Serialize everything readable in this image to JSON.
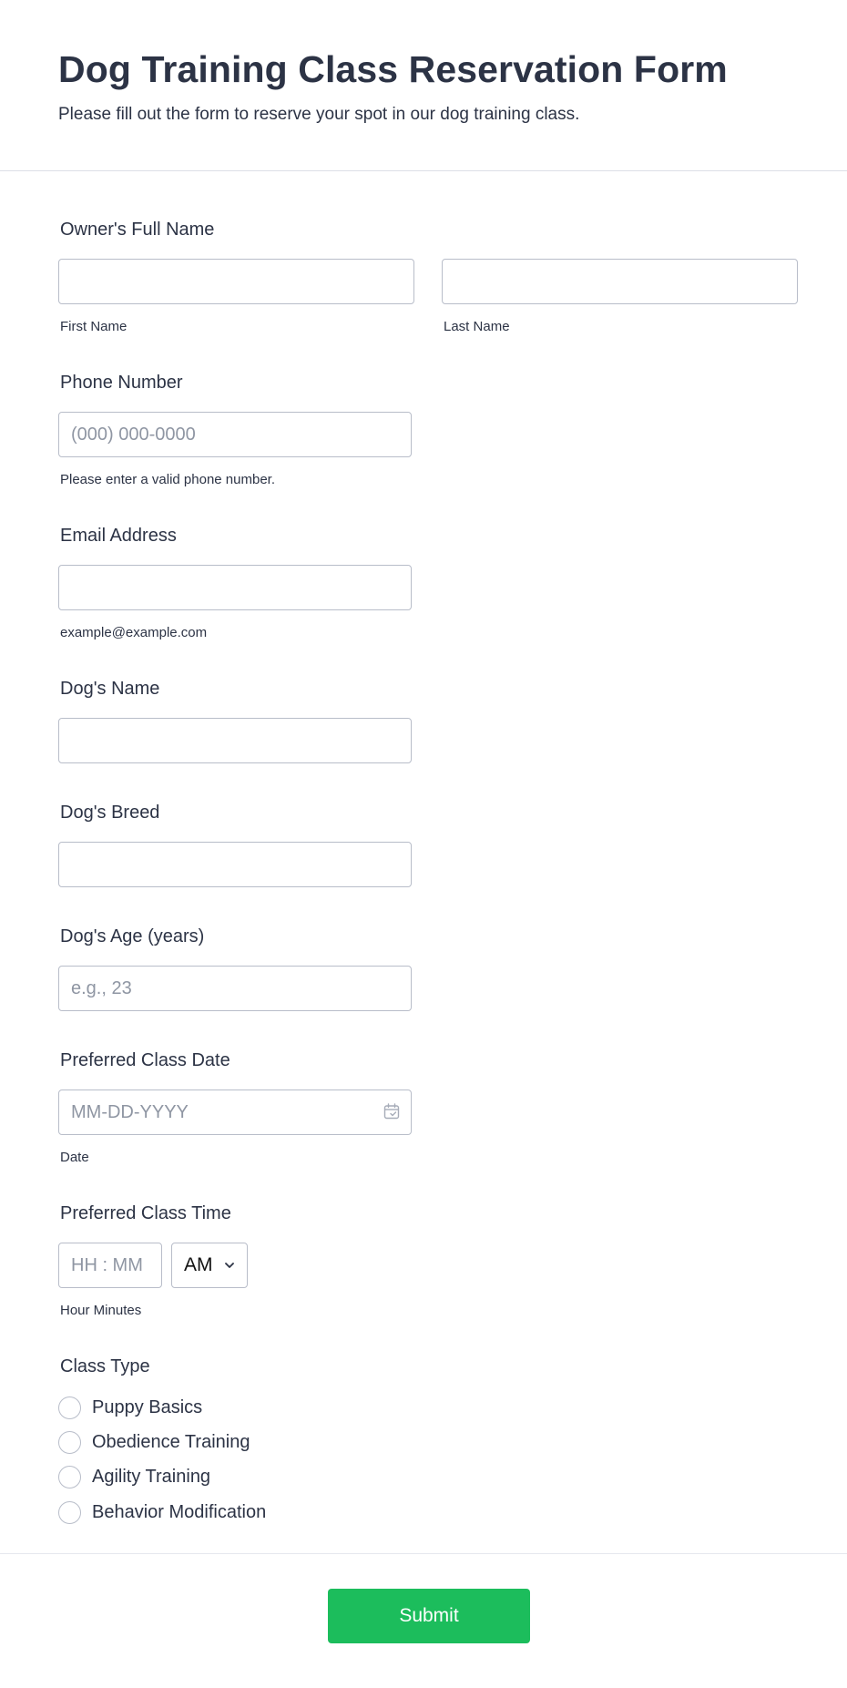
{
  "header": {
    "title": "Dog Training Class Reservation Form",
    "subtitle": "Please fill out the form to reserve your spot in our dog training class."
  },
  "owner_name": {
    "label": "Owner's Full Name",
    "first_value": "",
    "last_value": "",
    "first_sublabel": "First Name",
    "last_sublabel": "Last Name"
  },
  "phone": {
    "label": "Phone Number",
    "placeholder": "(000) 000-0000",
    "sublabel": "Please enter a valid phone number."
  },
  "email": {
    "label": "Email Address",
    "sublabel": "example@example.com"
  },
  "dog_name": {
    "label": "Dog's Name"
  },
  "dog_breed": {
    "label": "Dog's Breed"
  },
  "dog_age": {
    "label": "Dog's Age (years)",
    "placeholder": "e.g., 23"
  },
  "class_date": {
    "label": "Preferred Class Date",
    "placeholder": "MM-DD-YYYY",
    "sublabel": "Date",
    "icon": "calendar-icon"
  },
  "class_time": {
    "label": "Preferred Class Time",
    "placeholder": "HH : MM",
    "ampm_selected": "AM",
    "sublabel": "Hour Minutes",
    "icon": "chevron-down-icon"
  },
  "class_type": {
    "label": "Class Type",
    "options": [
      "Puppy Basics",
      "Obedience Training",
      "Agility Training",
      "Behavior Modification"
    ]
  },
  "submit": {
    "label": "Submit"
  },
  "colors": {
    "accent": "#1cbd5c",
    "text": "#2c3345",
    "border": "#b8bdc9",
    "placeholder": "#8f96a3"
  }
}
